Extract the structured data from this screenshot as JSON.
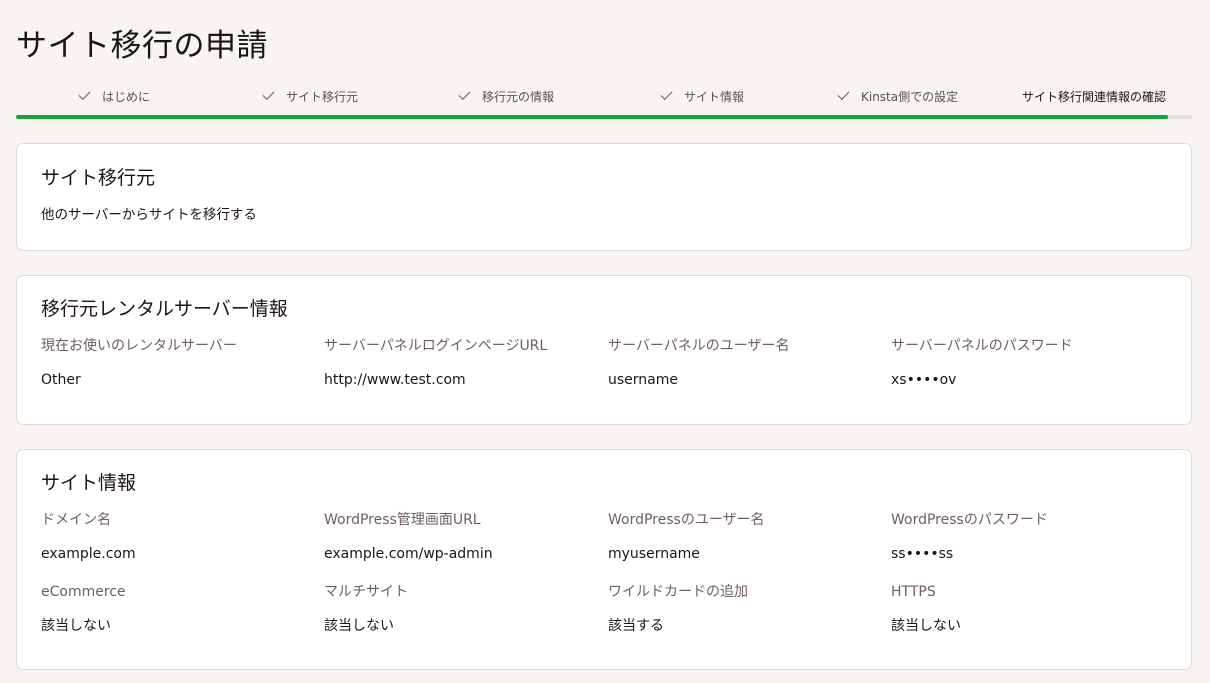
{
  "page": {
    "title": "サイト移行の申請"
  },
  "steps": [
    {
      "label": "はじめに",
      "completed": true
    },
    {
      "label": "サイト移行元",
      "completed": true
    },
    {
      "label": "移行元の情報",
      "completed": true
    },
    {
      "label": "サイト情報",
      "completed": true
    },
    {
      "label": "Kinsta側での設定",
      "completed": true
    },
    {
      "label": "サイト移行関連情報の確認",
      "completed": false
    }
  ],
  "progress": {
    "percent": 98,
    "color": "#13a339"
  },
  "source": {
    "title": "サイト移行元",
    "text": "他のサーバーからサイトを移行する"
  },
  "hosting": {
    "title": "移行元レンタルサーバー情報",
    "fields": [
      {
        "label": "現在お使いのレンタルサーバー",
        "value": "Other"
      },
      {
        "label": "サーバーパネルログインページURL",
        "value": "http://www.test.com"
      },
      {
        "label": "サーバーパネルのユーザー名",
        "value": "username"
      },
      {
        "label": "サーバーパネルのパスワード",
        "value": "xs••••ov"
      }
    ]
  },
  "site": {
    "title": "サイト情報",
    "fields": [
      {
        "label": "ドメイン名",
        "value": "example.com"
      },
      {
        "label": "WordPress管理画面URL",
        "value": "example.com/wp-admin"
      },
      {
        "label": "WordPressのユーザー名",
        "value": "myusername"
      },
      {
        "label": "WordPressのパスワード",
        "value": "ss••••ss"
      },
      {
        "label": "eCommerce",
        "value": "該当しない"
      },
      {
        "label": "マルチサイト",
        "value": "該当しない"
      },
      {
        "label": "ワイルドカードの追加",
        "value": "該当する"
      },
      {
        "label": "HTTPS",
        "value": "該当しない"
      }
    ]
  }
}
